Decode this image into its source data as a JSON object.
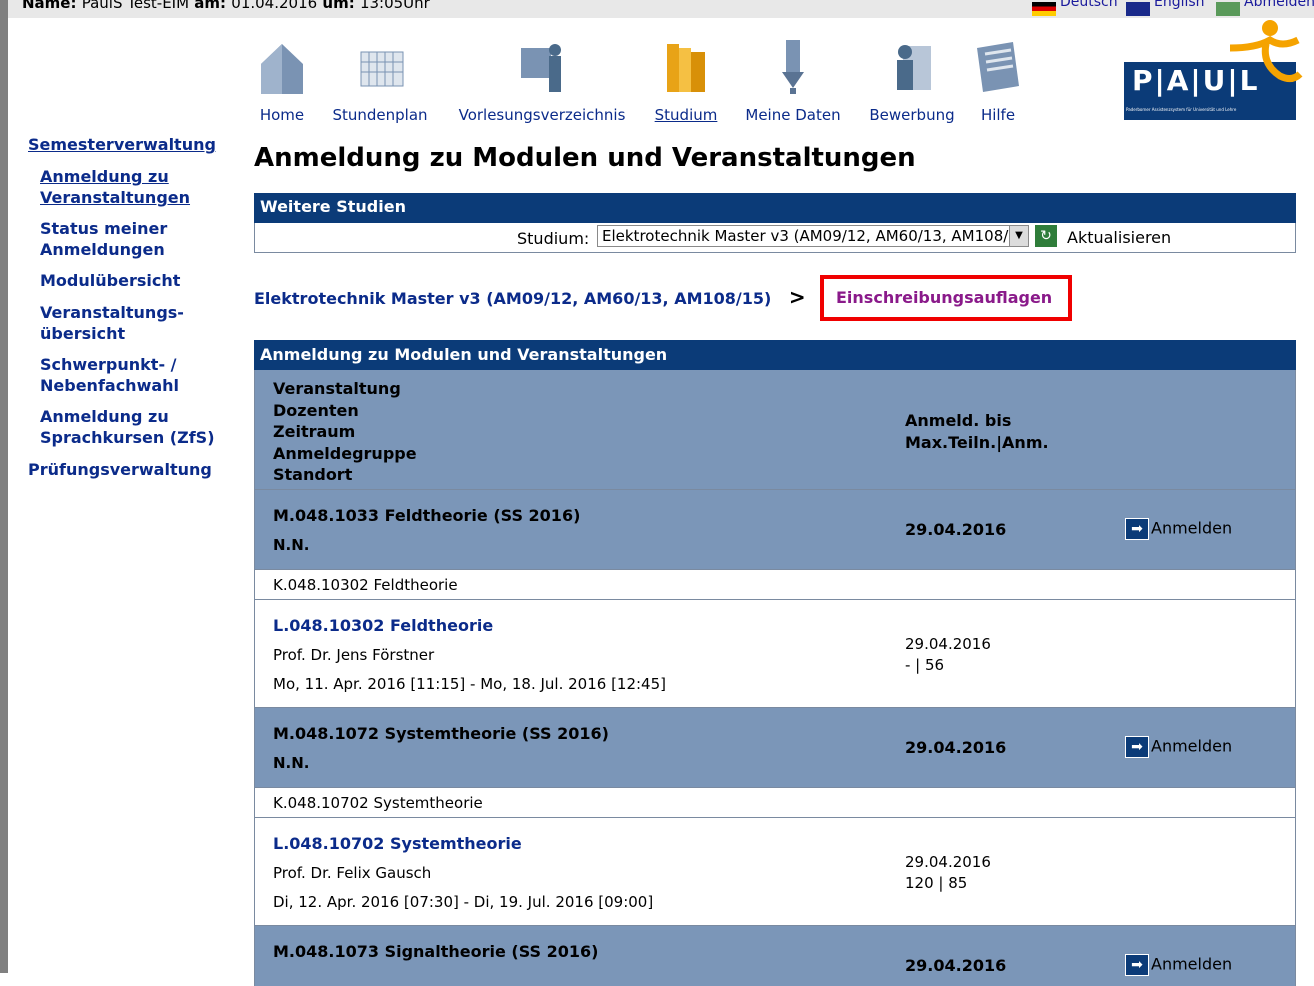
{
  "header": {
    "name_label": "Name:",
    "name_value": "PaulS Test-EIM",
    "date_label": "am:",
    "date_value": "01.04.2016",
    "time_label": "um:",
    "time_value": "13:05Uhr",
    "lang_de": "Deutsch",
    "lang_en": "English",
    "logout": "Abmelden"
  },
  "nav": [
    {
      "label": "Home",
      "icon": "home-icon"
    },
    {
      "label": "Stundenplan",
      "icon": "calendar-icon"
    },
    {
      "label": "Vorlesungsverzeichnis",
      "icon": "lecture-icon"
    },
    {
      "label": "Studium",
      "icon": "binders-icon",
      "active": true
    },
    {
      "label": "Meine Daten",
      "icon": "data-icon"
    },
    {
      "label": "Bewerbung",
      "icon": "application-icon"
    },
    {
      "label": "Hilfe",
      "icon": "help-icon"
    }
  ],
  "logo": {
    "text": "P|A|U|L",
    "subtitle": "Paderborner Assistenzsystem für Universität und Lehre",
    "accent": "#f5a300"
  },
  "sidebar": {
    "section": "Semesterverwaltung",
    "items": [
      "Anmeldung zu Veranstaltungen",
      "Status meiner Anmeldungen",
      "Modulübersicht",
      "Veranstaltungs-übersicht",
      "Schwerpunkt- / Nebenfachwahl",
      "Anmeldung zu Sprachkursen (ZfS)"
    ],
    "section2": "Prüfungsverwaltung"
  },
  "page": {
    "title": "Anmeldung zu Modulen und Veranstaltungen",
    "weitere": "Weitere Studien",
    "studium_label": "Studium:",
    "studium_value": "Elektrotechnik Master v3 (AM09/12, AM60/13, AM108/15)",
    "refresh": "Aktualisieren",
    "crumb": "Elektrotechnik Master v3 (AM09/12, AM60/13, AM108/15)",
    "crumb_sep": ">",
    "auflagen": "Einschreibungsauflagen"
  },
  "table": {
    "title": "Anmeldung zu Modulen und Veranstaltungen",
    "col1": [
      "Veranstaltung",
      "Dozenten",
      "Zeitraum",
      "Anmeldegruppe",
      "Standort"
    ],
    "col2": [
      "Anmeld. bis",
      "Max.Teiln.|Anm."
    ],
    "anmelden": "Anmelden",
    "modules": [
      {
        "code": "M.048.1033 Feldtheorie (SS 2016)",
        "doz": "N.N.",
        "date": "29.04.2016",
        "kurs": "K.048.10302 Feldtheorie",
        "lv": "L.048.10302 Feldtheorie",
        "lv_doz": "Prof. Dr. Jens Förstner",
        "lv_zeit": "Mo, 11. Apr. 2016 [11:15] - Mo, 18. Jul. 2016 [12:45]",
        "lv_date": "29.04.2016",
        "lv_count": "- | 56"
      },
      {
        "code": "M.048.1072 Systemtheorie (SS 2016)",
        "doz": "N.N.",
        "date": "29.04.2016",
        "kurs": "K.048.10702 Systemtheorie",
        "lv": "L.048.10702 Systemtheorie",
        "lv_doz": "Prof. Dr. Felix Gausch",
        "lv_zeit": "Di, 12. Apr. 2016 [07:30] - Di, 19. Jul. 2016 [09:00]",
        "lv_date": "29.04.2016",
        "lv_count": "120 | 85"
      },
      {
        "code": "M.048.1073 Signaltheorie (SS 2016)",
        "date": "29.04.2016"
      }
    ]
  }
}
